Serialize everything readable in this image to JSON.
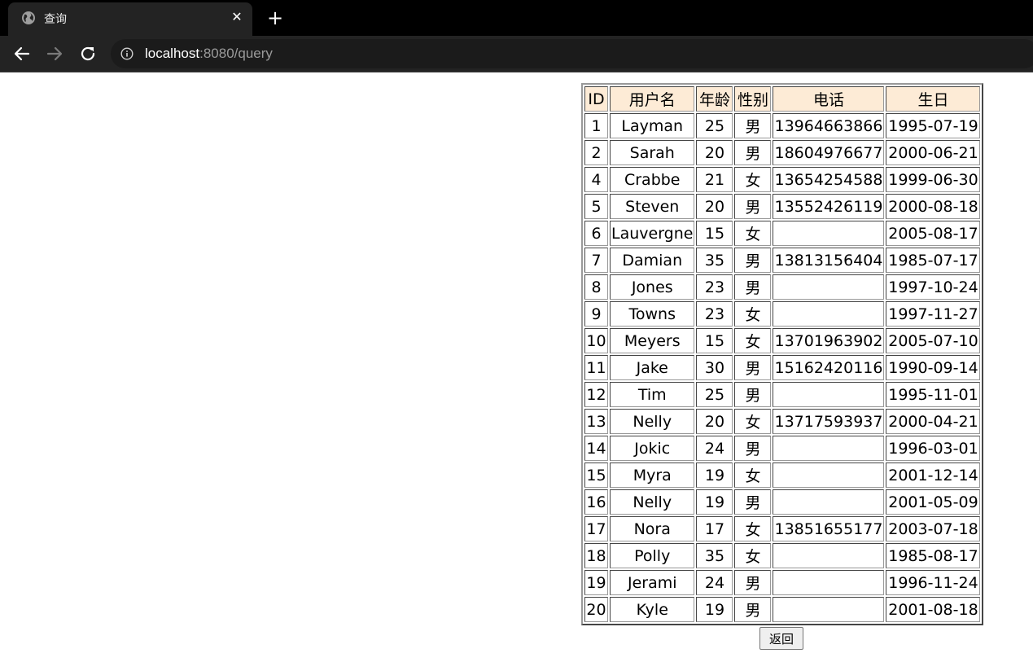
{
  "browser": {
    "tab_title": "查询",
    "tab_close_glyph": "✕",
    "new_tab_glyph": "+",
    "url_host": "localhost",
    "url_path": ":8080/query",
    "icons": {
      "tab": "globe-icon",
      "back": "arrow-left-icon",
      "forward": "arrow-right-icon",
      "reload": "reload-icon",
      "site_info": "info-icon"
    }
  },
  "table": {
    "header_bg": "#fdebd6",
    "columns": [
      "ID",
      "用户名",
      "年龄",
      "性别",
      "电话",
      "生日"
    ],
    "rows": [
      [
        "1",
        "Layman",
        "25",
        "男",
        "13964663866",
        "1995-07-19"
      ],
      [
        "2",
        "Sarah",
        "20",
        "男",
        "18604976677",
        "2000-06-21"
      ],
      [
        "4",
        "Crabbe",
        "21",
        "女",
        "13654254588",
        "1999-06-30"
      ],
      [
        "5",
        "Steven",
        "20",
        "男",
        "13552426119",
        "2000-08-18"
      ],
      [
        "6",
        "Lauvergne",
        "15",
        "女",
        "",
        "2005-08-17"
      ],
      [
        "7",
        "Damian",
        "35",
        "男",
        "13813156404",
        "1985-07-17"
      ],
      [
        "8",
        "Jones",
        "23",
        "男",
        "",
        "1997-10-24"
      ],
      [
        "9",
        "Towns",
        "23",
        "女",
        "",
        "1997-11-27"
      ],
      [
        "10",
        "Meyers",
        "15",
        "女",
        "13701963902",
        "2005-07-10"
      ],
      [
        "11",
        "Jake",
        "30",
        "男",
        "15162420116",
        "1990-09-14"
      ],
      [
        "12",
        "Tim",
        "25",
        "男",
        "",
        "1995-11-01"
      ],
      [
        "13",
        "Nelly",
        "20",
        "女",
        "13717593937",
        "2000-04-21"
      ],
      [
        "14",
        "Jokic",
        "24",
        "男",
        "",
        "1996-03-01"
      ],
      [
        "15",
        "Myra",
        "19",
        "女",
        "",
        "2001-12-14"
      ],
      [
        "16",
        "Nelly",
        "19",
        "男",
        "",
        "2001-05-09"
      ],
      [
        "17",
        "Nora",
        "17",
        "女",
        "13851655177",
        "2003-07-18"
      ],
      [
        "18",
        "Polly",
        "35",
        "女",
        "",
        "1985-08-17"
      ],
      [
        "19",
        "Jerami",
        "24",
        "男",
        "",
        "1996-11-24"
      ],
      [
        "20",
        "Kyle",
        "19",
        "男",
        "",
        "2001-08-18"
      ]
    ]
  },
  "back_button": "返回"
}
